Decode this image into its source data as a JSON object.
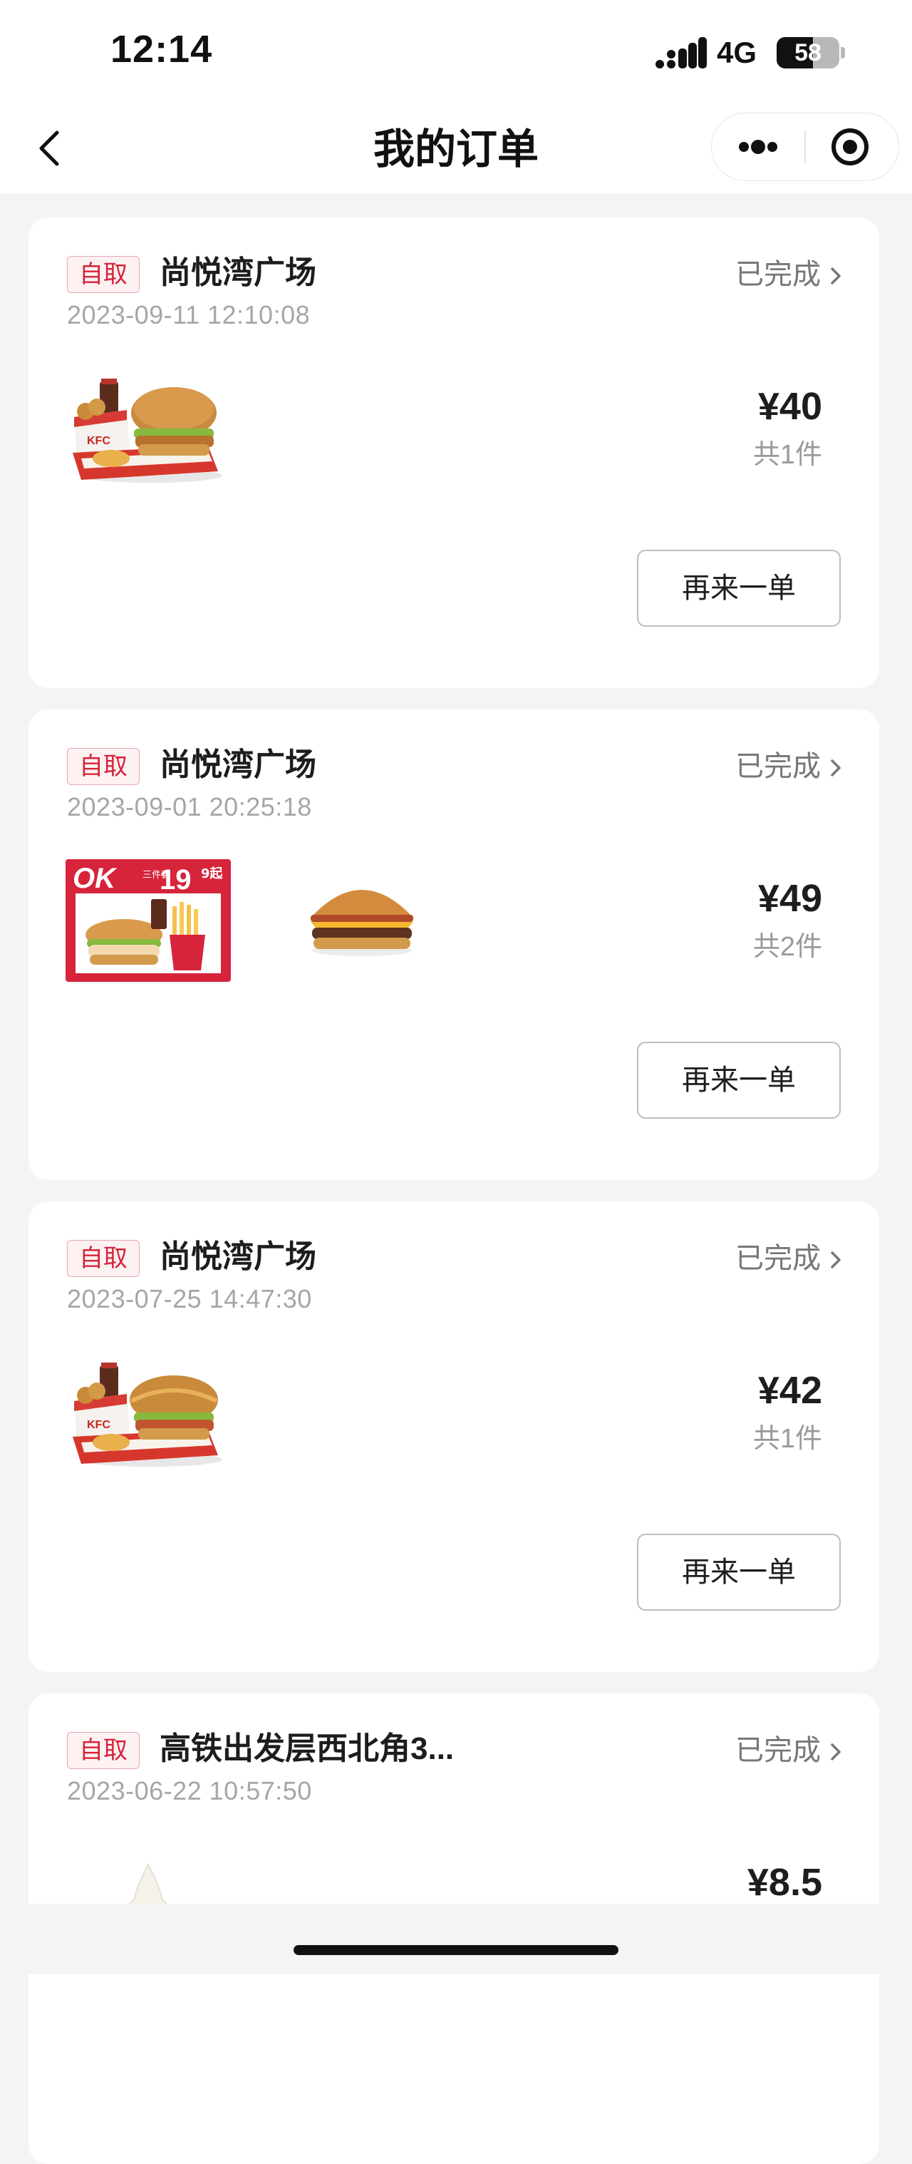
{
  "status_bar": {
    "time": "12:14",
    "network": "4G",
    "battery": "58",
    "battery_fraction": 0.58
  },
  "nav": {
    "title": "我的订单",
    "back_icon": "chevron-left-icon",
    "more_icon": "more-dots-icon",
    "close_icon": "target-circle-icon"
  },
  "orders": [
    {
      "badge": "自取",
      "store": "尚悦湾广场",
      "status": "已完成",
      "time": "2023-09-11 12:10:08",
      "price": "¥40",
      "qty": "共1件",
      "reorder": "再来一单",
      "items": [
        "combo-chicken-burger-meal"
      ]
    },
    {
      "badge": "自取",
      "store": "尚悦湾广场",
      "status": "已完成",
      "time": "2023-09-01 20:25:18",
      "price": "¥49",
      "qty": "共2件",
      "reorder": "再来一单",
      "items": [
        "ok-set-promo",
        "cheeseburger"
      ],
      "promo": {
        "brand": "OK",
        "tag": "三件套",
        "price": "19",
        "suffix": "9起"
      }
    },
    {
      "badge": "自取",
      "store": "尚悦湾广场",
      "status": "已完成",
      "time": "2023-07-25 14:47:30",
      "price": "¥42",
      "qty": "共1件",
      "reorder": "再来一单",
      "items": [
        "combo-chicken-burger-meal"
      ]
    },
    {
      "badge": "自取",
      "store": "高铁出发层西北角3...",
      "status": "已完成",
      "time": "2023-06-22 10:57:50",
      "price": "¥8.5",
      "qty": "",
      "reorder": "",
      "items": [
        "soft-serve-ice-cream"
      ]
    }
  ],
  "colors": {
    "page_bg": "#f4f4f4",
    "card_bg": "#ffffff",
    "badge_red": "#d6243b",
    "promo_red": "#d6243b"
  }
}
